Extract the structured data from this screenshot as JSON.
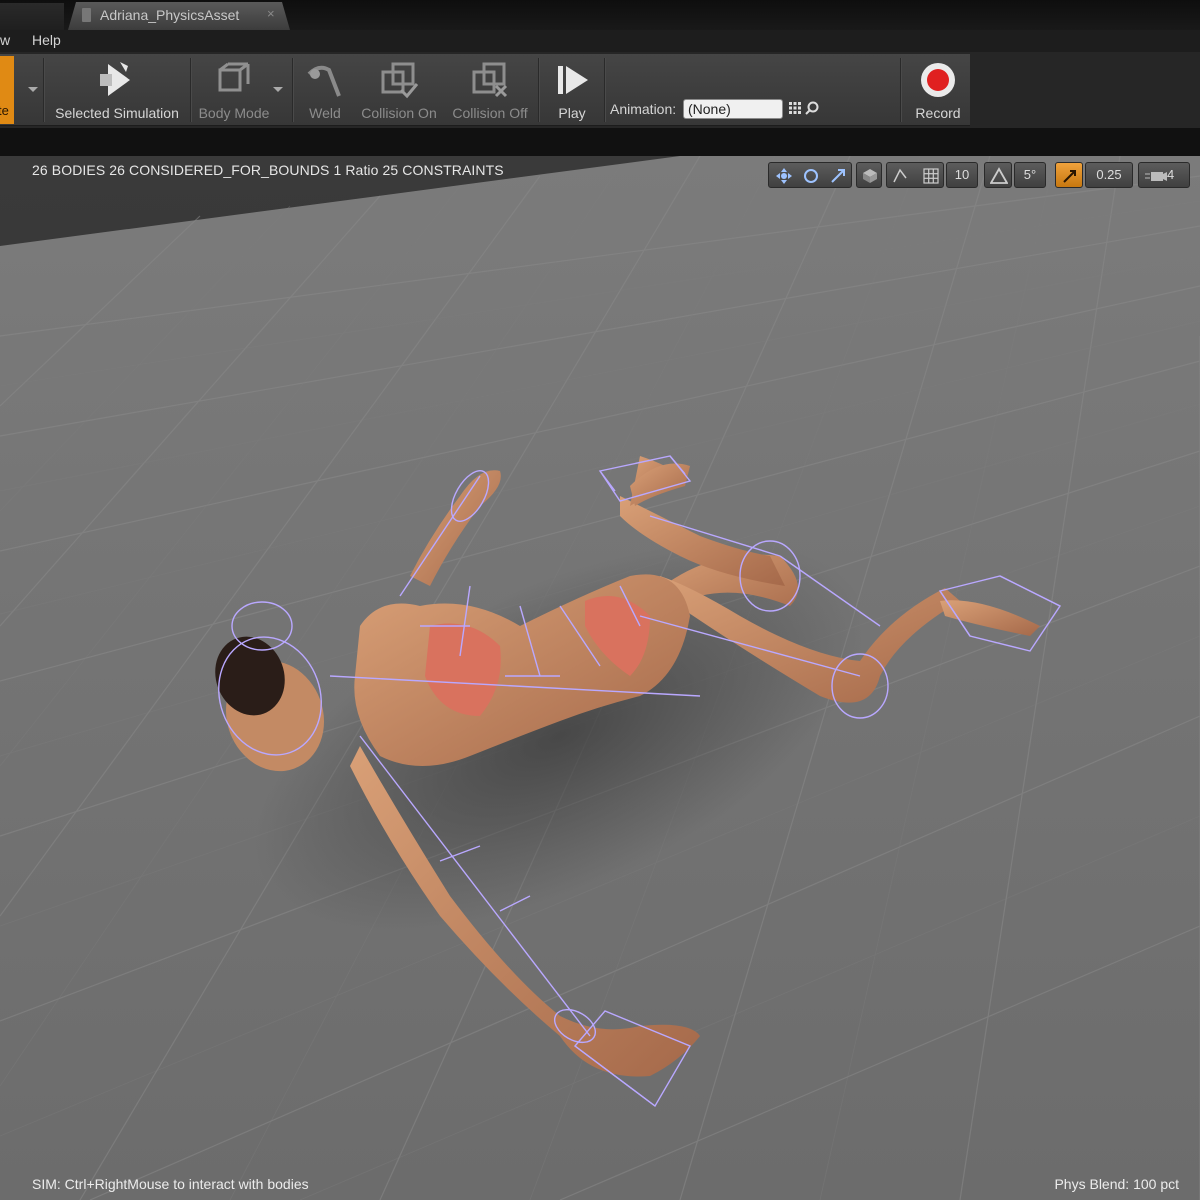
{
  "window": {
    "tab_title": "Adriana_PhysicsAsset",
    "tab_close": "×"
  },
  "menu": {
    "items": [
      "w",
      "Help"
    ]
  },
  "toolbar": {
    "orange_label": "te",
    "selected_simulation": "Selected Simulation",
    "body_mode": "Body Mode",
    "weld": "Weld",
    "collision_on": "Collision On",
    "collision_off": "Collision Off",
    "play": "Play",
    "animation_label": "Animation:",
    "animation_value": "(None)",
    "record": "Record"
  },
  "viewport": {
    "stats": "26 BODIES  26 CONSIDERED_FOR_BOUNDS  1 Ratio  25 CONSTRAINTS",
    "sim_hint": "SIM: Ctrl+RightMouse to interact with bodies",
    "phys_blend": "Phys Blend: 100 pct",
    "grid_snap_value": "10",
    "rotation_snap_value": "5°",
    "scale_snap_value": "0.25",
    "camera_speed_value": "4"
  },
  "colors": {
    "accent_orange": "#e08a14",
    "record_red": "#e02020",
    "wireframe": "#b9a8ff",
    "floor": "#727272"
  }
}
